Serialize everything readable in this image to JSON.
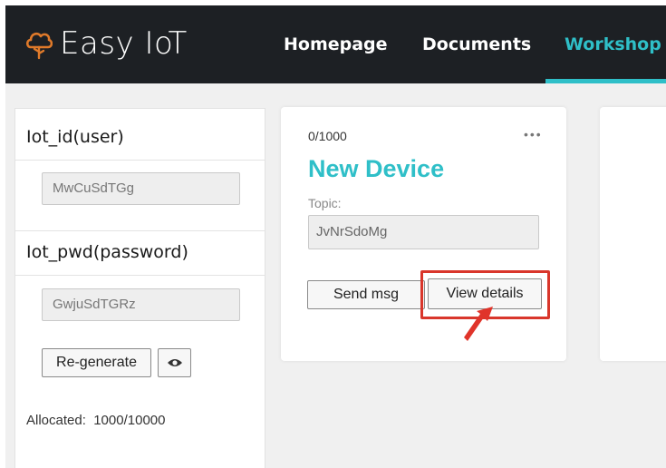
{
  "brand": {
    "name": "Easy IoT"
  },
  "nav": {
    "items": [
      {
        "label": "Homepage",
        "active": false
      },
      {
        "label": "Documents",
        "active": false
      },
      {
        "label": "Workshop",
        "active": true
      }
    ]
  },
  "credentials": {
    "user_label": "Iot_id(user)",
    "user_value": "MwCuSdTGg",
    "password_label": "Iot_pwd(password)",
    "password_value": "GwjuSdTGRz",
    "regenerate_label": "Re-generate",
    "show_icon": "eye-icon",
    "allocated_label": "Allocated:",
    "allocated_value": "1000/10000"
  },
  "device_card": {
    "counter": "0/1000",
    "more_icon": "•••",
    "title": "New Device",
    "topic_label": "Topic:",
    "topic_value": "JvNrSdoMg",
    "send_label": "Send msg",
    "details_label": "View details"
  },
  "colors": {
    "accent": "#2fbfc8",
    "topbar": "#1d2024",
    "highlight": "#d9362b"
  }
}
